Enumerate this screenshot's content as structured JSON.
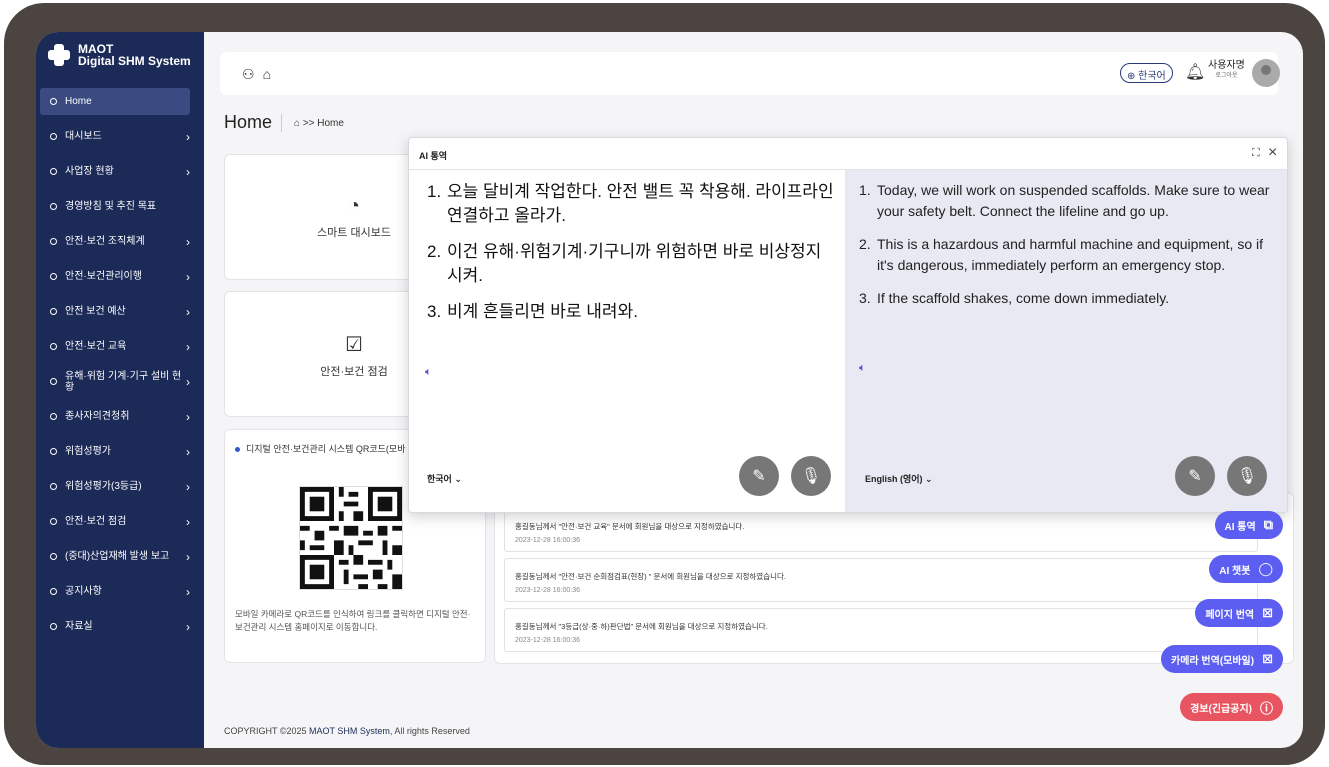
{
  "app": {
    "logo_line1": "MAOT",
    "logo_line2": "Digital SHM System"
  },
  "sidebar": {
    "items": [
      {
        "label": "Home",
        "active": true
      },
      {
        "label": "대시보드"
      },
      {
        "label": "사업장 현황"
      },
      {
        "label": "경영방침 및 추진 목표"
      },
      {
        "label": "안전·보건 조직체계"
      },
      {
        "label": "안전·보건관리이행"
      },
      {
        "label": "안전 보건 예산"
      },
      {
        "label": "안전·보건 교육"
      },
      {
        "label": "유해·위험 기계·기구 설비 현황"
      },
      {
        "label": "종사자의견청취"
      },
      {
        "label": "위험성평가"
      },
      {
        "label": "위험성평가(3등급)"
      },
      {
        "label": "안전·보건 점검"
      },
      {
        "label": "(중대)산업재해 발생 보고"
      },
      {
        "label": "공지사항"
      },
      {
        "label": "자료실"
      }
    ]
  },
  "topbar": {
    "language": "⊕ 한국어",
    "user_name": "사용자명",
    "logout": "로그아웃"
  },
  "page": {
    "title": "Home",
    "breadcrumb": "⌂ >> Home"
  },
  "cards": {
    "dashboard_label": "스마트 대시보드",
    "inspection_label": "안전·보건 점검",
    "qr_title": "디지털 안전·보건관리 시스템 QR코드(모바",
    "qr_desc": "모바일 카메라로 QR코드를 인식하여 링크를 클릭하면 디지털 안전·보건관리 시스템 홈페이지로 이동합니다."
  },
  "notifications": [
    {
      "message": "홍길동님께서 \"안전·보건 교육\" 문서에 회원님을 대상으로 지정하였습니다.",
      "time": "2023-12-28 16:00:36"
    },
    {
      "message": "홍길동님께서 \"안전·보건 순회점검표(현장) \" 문서에 회원님을 대상으로 지정하였습니다.",
      "time": "2023-12-28 16:00:36"
    },
    {
      "message": "홍길동님께서 \"3등급(상·중·하)판단법\" 문서에 회원님을 대상으로 지정하였습니다.",
      "time": "2023-12-28 16:00:36"
    }
  ],
  "footer": {
    "prefix": "COPYRIGHT ©2025 ",
    "brand": "MAOT SHM System",
    "suffix": ", All rights Reserved"
  },
  "translator": {
    "title": "AI 통역",
    "source_lang": "한국어 ⌄",
    "target_lang": "English (영어) ⌄",
    "source_lines": [
      {
        "n": "1.",
        "text": "오늘 달비계 작업한다. 안전 밸트 꼭 착용해. 라이프라인 연결하고 올라가."
      },
      {
        "n": "2.",
        "text": "이건 유해·위험기계·기구니까 위험하면 바로 비상정지 시켜."
      },
      {
        "n": "3.",
        "text": "비계 흔들리면 바로 내려와."
      }
    ],
    "target_lines": [
      {
        "n": "1.",
        "text": "Today, we will work on suspended scaffolds. Make sure to wear your safety belt. Connect the lifeline and go up."
      },
      {
        "n": "2.",
        "text": "This is a hazardous and harmful machine and equipment, so if it's dangerous, immediately perform an emergency stop."
      },
      {
        "n": "3.",
        "text": "If the scaffold shakes, come down immediately."
      }
    ]
  },
  "fabs": {
    "ai_translate": "AI 통역",
    "ai_chat": "AI 챗봇",
    "page_translate": "페이지 번역",
    "camera_translate": "카메라 번역(모바일)",
    "alert": "경보(긴급공지)"
  },
  "colors": {
    "sidebar": "#1c2a57",
    "fab": "#5b5ef0",
    "alert": "#e85561",
    "translation_pane": "#e8e9f2"
  }
}
